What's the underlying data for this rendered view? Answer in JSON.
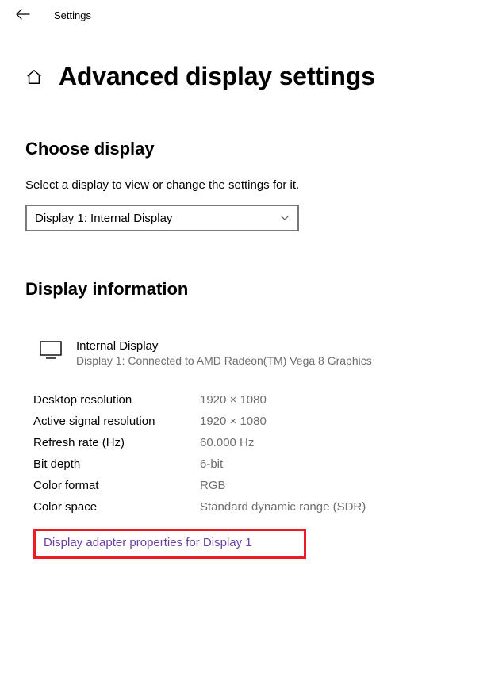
{
  "topbar": {
    "title": "Settings"
  },
  "page": {
    "title": "Advanced display settings"
  },
  "choose": {
    "heading": "Choose display",
    "subtext": "Select a display to view or change the settings for it.",
    "dropdown_value": "Display 1: Internal Display"
  },
  "info": {
    "heading": "Display information",
    "display_name": "Internal Display",
    "display_connection": "Display 1: Connected to AMD Radeon(TM) Vega 8 Graphics",
    "rows": {
      "desktop_resolution": {
        "label": "Desktop resolution",
        "value": "1920 × 1080"
      },
      "active_signal_resolution": {
        "label": "Active signal resolution",
        "value": "1920 × 1080"
      },
      "refresh_rate": {
        "label": "Refresh rate (Hz)",
        "value": "60.000 Hz"
      },
      "bit_depth": {
        "label": "Bit depth",
        "value": "6-bit"
      },
      "color_format": {
        "label": "Color format",
        "value": "RGB"
      },
      "color_space": {
        "label": "Color space",
        "value": "Standard dynamic range (SDR)"
      }
    },
    "adapter_link": "Display adapter properties for Display 1"
  },
  "highlight_color": "#ec1c24"
}
